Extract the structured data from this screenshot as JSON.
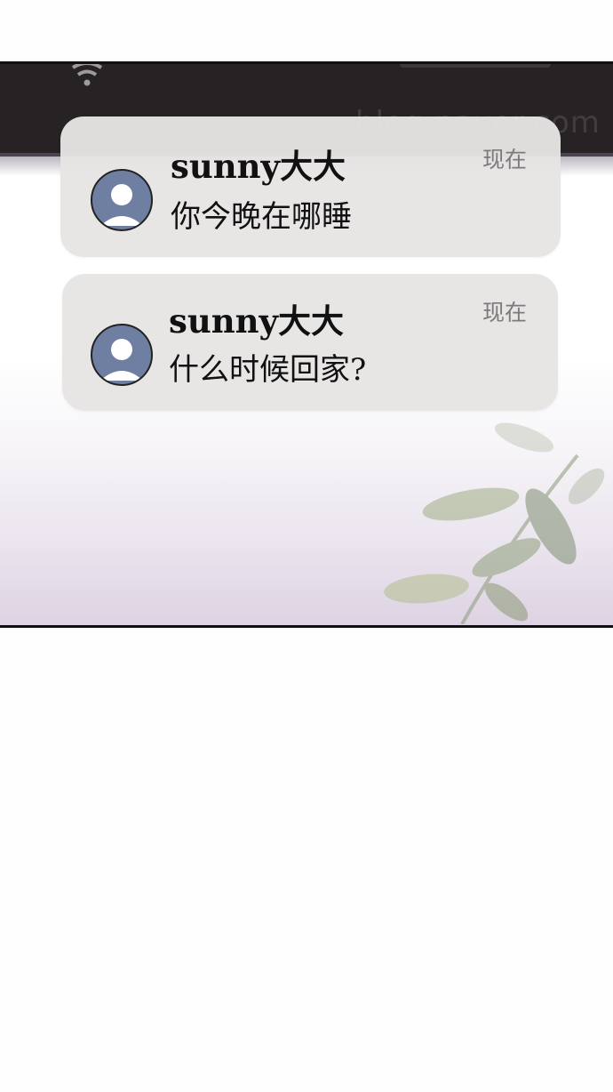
{
  "notifications": [
    {
      "sender": "sunny大大",
      "message": "你今晚在哪睡",
      "time": "现在",
      "avatar_icon": "person-avatar-icon"
    },
    {
      "sender": "sunny大大",
      "message": "什么时候回家?",
      "time": "现在",
      "avatar_icon": "person-avatar-icon"
    }
  ],
  "status_bar": {
    "icons": [
      "wifi-icon"
    ]
  },
  "colors": {
    "status_bar_bg": "#272224",
    "notification_bg": "#e7e4e4",
    "avatar_bg": "#6e7fa2",
    "time_text": "#7b7b7b"
  }
}
